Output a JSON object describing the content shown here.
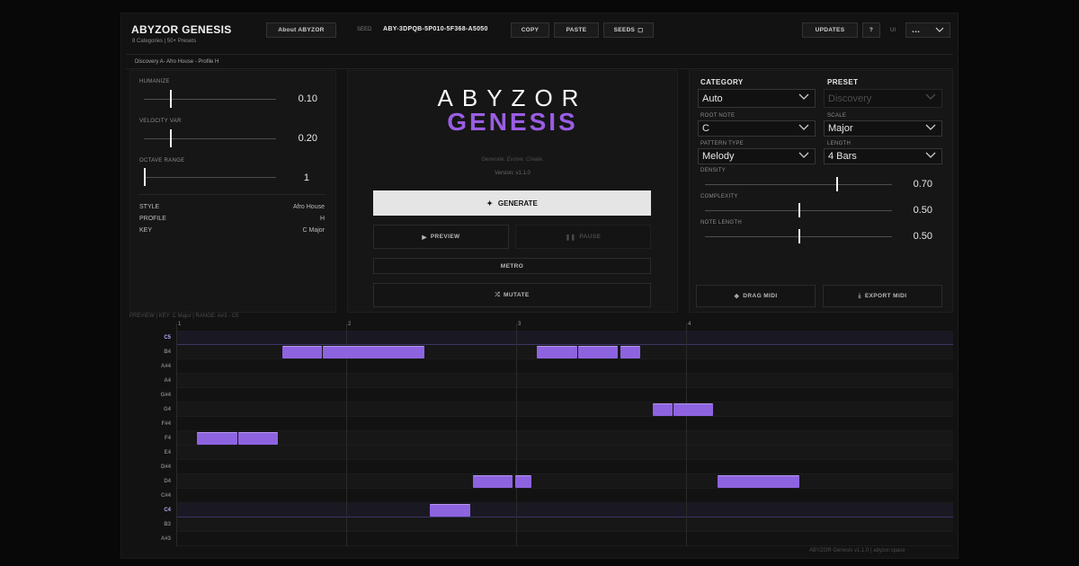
{
  "app": {
    "title": "ABYZOR GENESIS",
    "subtitle": "8 Categories | 50+ Presets"
  },
  "toolbar": {
    "about_label": "About ABYZOR",
    "seed_label": "SEED",
    "seed_value": "ABY-3DPQB-5P010-5F368-A5050",
    "copy_label": "COPY",
    "paste_label": "PASTE",
    "seeds_label": "SEEDS",
    "seeds_glyph": "☐",
    "updates_label": "UPDATES",
    "help_label": "?",
    "ui_label": "UI",
    "ui_select_value": "..."
  },
  "breadcrumb": "Discovery A- Afro House - Profile H",
  "left_panel": {
    "humanize": {
      "label": "HUMANIZE",
      "value": "0.10",
      "level": 0.1
    },
    "velocity_var": {
      "label": "VELOCITY VAR",
      "value": "0.20",
      "level": 0.2
    },
    "octave_range": {
      "label": "OCTAVE RANGE",
      "value": "1",
      "level": 0.0
    },
    "info": [
      {
        "key": "STYLE",
        "value": "Afro House"
      },
      {
        "key": "PROFILE",
        "value": "H"
      },
      {
        "key": "KEY",
        "value": "C Major"
      }
    ]
  },
  "center": {
    "logo_top": "ABYZOR",
    "logo_bottom": "GENESIS",
    "tagline": "Generate. Evolve. Create.",
    "version": "Version: v1.1.0",
    "generate_glyph": "✦",
    "generate_label": "GENERATE",
    "preview_glyph": "▶",
    "preview_label": "PREVIEW",
    "pause_glyph": "❚❚",
    "pause_label": "PAUSE",
    "metro_label": "METRO",
    "mutate_glyph": "⤮",
    "mutate_label": "MUTATE"
  },
  "right_panel": {
    "category": {
      "label": "CATEGORY",
      "value": "Auto"
    },
    "preset": {
      "label": "PRESET",
      "value": "Discovery"
    },
    "root_note": {
      "label": "ROOT NOTE",
      "value": "C"
    },
    "scale": {
      "label": "SCALE",
      "value": "Major"
    },
    "pattern_type": {
      "label": "PATTERN TYPE",
      "value": "Melody"
    },
    "length": {
      "label": "LENGTH",
      "value": "4 Bars"
    },
    "density": {
      "label": "DENSITY",
      "value": "0.70",
      "level": 0.7
    },
    "complexity": {
      "label": "COMPLEXITY",
      "value": "0.50",
      "level": 0.5
    },
    "note_length": {
      "label": "NOTE LENGTH",
      "value": "0.50",
      "level": 0.5
    },
    "drag_midi_glyph": "✥",
    "drag_midi_label": "DRAG MIDI",
    "export_midi_glyph": "⤓",
    "export_midi_label": "EXPORT MIDI"
  },
  "preview_bar": "PREVIEW  |  KEY: C Major  |  RANGE: A#3 - C5",
  "piano_roll": {
    "keys": [
      "C5",
      "B4",
      "A#4",
      "A4",
      "G#4",
      "G4",
      "F#4",
      "F4",
      "E4",
      "D#4",
      "D4",
      "C#4",
      "C4",
      "B3",
      "A#3"
    ],
    "bars": [
      "1",
      "2",
      "3",
      "4"
    ],
    "notes": [
      {
        "pitch": "B4",
        "start": 0.56,
        "length": 0.24
      },
      {
        "pitch": "B4",
        "start": 0.8,
        "length": 0.6
      },
      {
        "pitch": "B4",
        "start": 2.06,
        "length": 0.24
      },
      {
        "pitch": "B4",
        "start": 2.3,
        "length": 0.24
      },
      {
        "pitch": "B4",
        "start": 2.55,
        "length": 0.12
      },
      {
        "pitch": "G4",
        "start": 2.74,
        "length": 0.12
      },
      {
        "pitch": "G4",
        "start": 2.86,
        "length": 0.24
      },
      {
        "pitch": "F4",
        "start": 0.06,
        "length": 0.24
      },
      {
        "pitch": "F4",
        "start": 0.3,
        "length": 0.24
      },
      {
        "pitch": "D4",
        "start": 1.68,
        "length": 0.24
      },
      {
        "pitch": "D4",
        "start": 1.93,
        "length": 0.1
      },
      {
        "pitch": "D4",
        "start": 3.12,
        "length": 0.49
      },
      {
        "pitch": "C4",
        "start": 1.43,
        "length": 0.24
      }
    ]
  },
  "footer": "ABYZOR Genesis v1.1.0  |  abyzor.space",
  "colors": {
    "accent": "#9b5de5",
    "note": "#8e63e0",
    "background": "#121212"
  }
}
